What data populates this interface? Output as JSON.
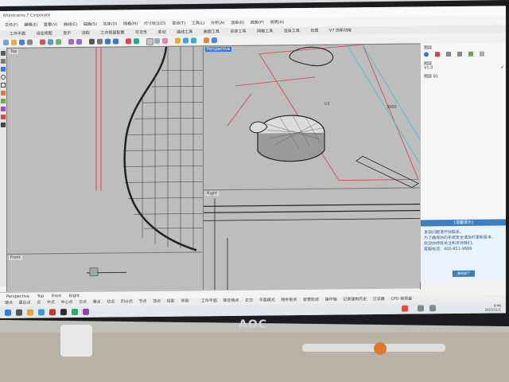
{
  "window": {
    "title": "Rhinoceros 7 Corporate"
  },
  "menu": [
    "文件(F)",
    "编辑(E)",
    "查看(V)",
    "曲线(C)",
    "曲面(S)",
    "实体(O)",
    "网格(M)",
    "尺寸标注(D)",
    "变动(T)",
    "工具(L)",
    "分析(A)",
    "渲染(R)",
    "面板(P)",
    "说明(H)"
  ],
  "tabs": [
    "工作平面",
    "设定视图",
    "显示",
    "选取",
    "工作视窗配置",
    "可见性",
    "变动",
    "曲线工具",
    "曲面工具",
    "实体工具",
    "网格工具",
    "渲染工具",
    "出图",
    "V7 的新功能"
  ],
  "viewports": {
    "top": "Top",
    "perspective": "Perspective",
    "front": "Front",
    "right": "Right"
  },
  "persp_dims": [
    "U1",
    "3000"
  ],
  "layers": {
    "title": "图层",
    "subtitle": "图层",
    "rows": [
      "V1.0",
      "图层 01"
    ]
  },
  "help": {
    "title": "[温馨提示]",
    "lines": [
      "发现问题请尽快联系。",
      "为了确保你的系统安全请及时更新版本。",
      "欢迎你持续关注和支持我们。",
      "客服电话：400-851-9686"
    ],
    "button": "我知道了"
  },
  "cmd_tabs": [
    "Perspective",
    "Top",
    "Front",
    "Right"
  ],
  "status": [
    "端点",
    "最近点",
    "点",
    "中点",
    "中心点",
    "交点",
    "垂点",
    "切点",
    "四分点",
    "节点",
    "顶点",
    "投影",
    "停用"
  ],
  "status2": [
    "工作平面",
    "锁定格点",
    "正交",
    "平面模式",
    "物件锁点",
    "智慧轨迹",
    "操作轴",
    "记录建构历史",
    "过滤器",
    "CPU 使用量"
  ],
  "clock": {
    "time": "9:46",
    "date": "2023/11/1"
  },
  "monitor_brand": "AOC",
  "colors": {
    "accent": "#3a78d4",
    "viewport": "#bdbdbd",
    "red_line": "#e0404a",
    "cyan_line": "#39c3d6"
  }
}
